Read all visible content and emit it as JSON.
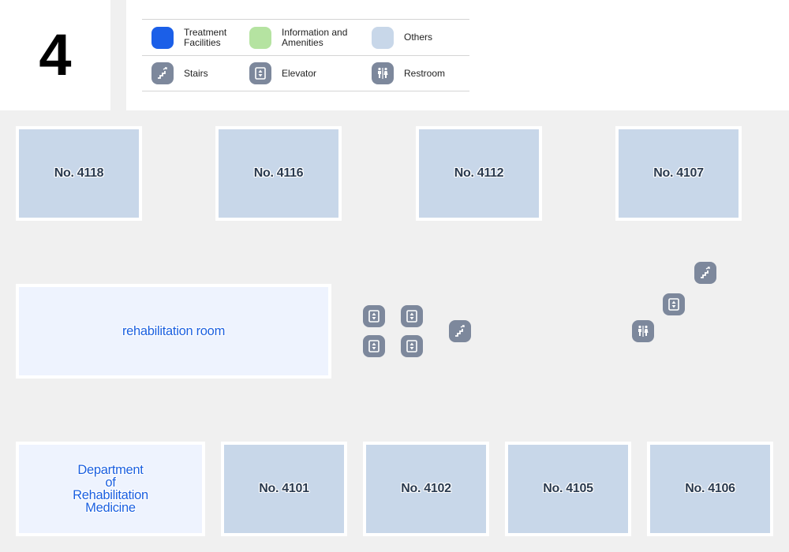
{
  "floor": {
    "number": "4"
  },
  "legend": {
    "colors": {
      "treatment": "#1b5fe8",
      "information": "#b5e3a1",
      "others": "#c8d7e9",
      "poi": "#7d889c"
    },
    "rows": [
      [
        {
          "type": "swatch",
          "key": "treatment",
          "label_line1": "Treatment",
          "label_line2": "Facilities"
        },
        {
          "type": "swatch",
          "key": "information",
          "label_line1": "Information and",
          "label_line2": "Amenities"
        },
        {
          "type": "swatch",
          "key": "others",
          "label_line1": "Others",
          "label_line2": ""
        }
      ],
      [
        {
          "type": "icon",
          "icon": "stairs-icon",
          "label_line1": "Stairs"
        },
        {
          "type": "icon",
          "icon": "elevator-icon",
          "label_line1": "Elevator"
        },
        {
          "type": "icon",
          "icon": "restroom-icon",
          "label_line1": "Restroom"
        }
      ]
    ]
  },
  "rooms": {
    "top": [
      "No. 4118",
      "No. 4116",
      "No. 4112",
      "No. 4107"
    ],
    "rehab_room": "rehabilitation room",
    "department": {
      "line1": "Department",
      "line2": "of",
      "line3": "Rehabilitation",
      "line4": "Medicine"
    },
    "bottom": [
      "No. 4101",
      "No. 4102",
      "No. 4105",
      "No. 4106"
    ]
  },
  "facilities": [
    {
      "type": "elevator",
      "icon": "elevator-icon"
    },
    {
      "type": "elevator",
      "icon": "elevator-icon"
    },
    {
      "type": "elevator",
      "icon": "elevator-icon"
    },
    {
      "type": "elevator",
      "icon": "elevator-icon"
    },
    {
      "type": "stairs",
      "icon": "stairs-icon"
    },
    {
      "type": "stairs",
      "icon": "stairs-icon"
    },
    {
      "type": "elevator",
      "icon": "elevator-icon"
    },
    {
      "type": "restroom",
      "icon": "restroom-icon"
    }
  ]
}
